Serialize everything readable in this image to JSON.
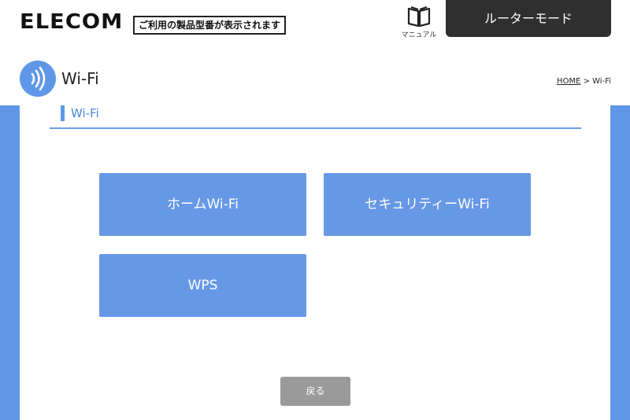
{
  "header": {
    "logo_text": "ELECOM",
    "model_notice": "ご利用の製品型番が表示されます",
    "manual_label": "マニュアル",
    "mode_button": "ルーターモード"
  },
  "page": {
    "title": "Wi-Fi",
    "breadcrumb_home": "HOME",
    "breadcrumb_separator": " > ",
    "breadcrumb_current": "Wi-Fi"
  },
  "section": {
    "title": "Wi-Fi"
  },
  "tiles": [
    {
      "label": "ホームWi-Fi"
    },
    {
      "label": "セキュリティーWi-Fi"
    },
    {
      "label": "WPS"
    }
  ],
  "back_button": "戻る",
  "colors": {
    "accent": "#6698e6",
    "dark": "#2f2f2f",
    "back_button": "#9a9a9a"
  },
  "icons": {
    "manual": "book-icon",
    "wifi": "wifi-signal-icon"
  }
}
